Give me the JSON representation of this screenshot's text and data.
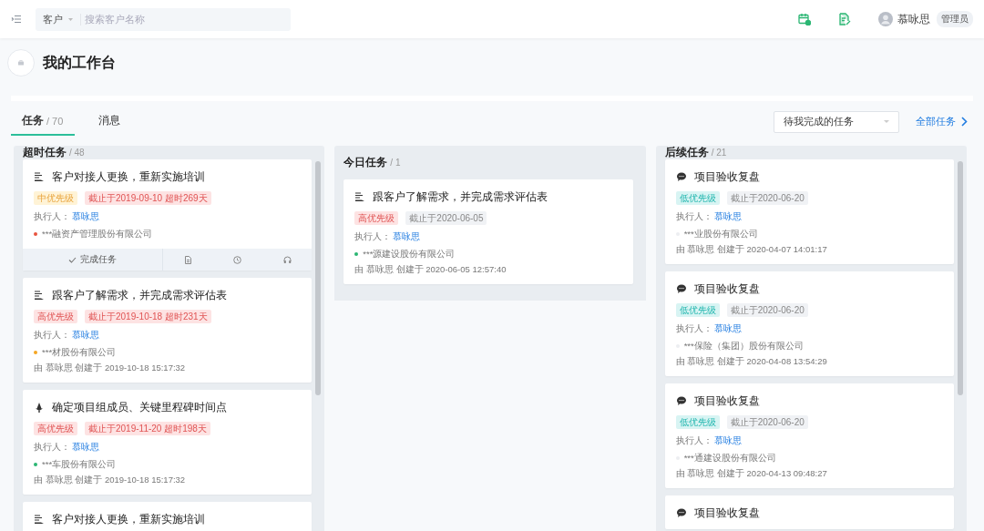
{
  "header": {
    "scope": "客户",
    "placeholder": "搜索客户名称",
    "user": {
      "name": "慕咏思",
      "role": "管理员"
    }
  },
  "page": {
    "title": "我的工作台"
  },
  "tabs": [
    {
      "label": "任务",
      "count": "/ 70",
      "selected": true
    },
    {
      "label": "消息",
      "selected": false
    }
  ],
  "filter": {
    "value": "待我完成的任务"
  },
  "all_link": "全部任务",
  "columns": [
    {
      "title": "超时任务",
      "count": "/ 48",
      "scrollbar": true,
      "cards": [
        {
          "kind": "list",
          "title": "客户对接人更换，重新实施培训",
          "priority": {
            "label": "中优先级",
            "kind": "mid"
          },
          "deadline": {
            "label": "截止于2019-09-10 超时269天",
            "overdue": true
          },
          "assignee_label": "执行人：",
          "assignee": "慕咏思",
          "company": "***融资产管理股份有限公司",
          "color": "#e8543f",
          "actions": {
            "complete": "完成任务"
          }
        },
        {
          "kind": "list",
          "title": "跟客户了解需求，并完成需求评估表",
          "priority": {
            "label": "高优先级",
            "kind": "high"
          },
          "deadline": {
            "label": "截止于2019-10-18 超时231天",
            "overdue": true
          },
          "assignee_label": "执行人：",
          "assignee": "慕咏思",
          "company": "***材股份有限公司",
          "color": "#f5a623",
          "created": "由 慕咏思 创建于 2019-10-18 15:17:32"
        },
        {
          "kind": "bell",
          "title": "确定项目组成员、关键里程碑时间点",
          "priority": {
            "label": "高优先级",
            "kind": "high"
          },
          "deadline": {
            "label": "截止于2019-11-20 超时198天",
            "overdue": true
          },
          "assignee_label": "执行人：",
          "assignee": "慕咏思",
          "company": "***车股份有限公司",
          "color": "#2bb673",
          "created": "由 慕咏思 创建于 2019-10-18 15:17:32"
        },
        {
          "kind": "list",
          "title": "客户对接人更换，重新实施培训"
        }
      ]
    },
    {
      "title": "今日任务",
      "count": "/ 1",
      "scrollbar": false,
      "cards": [
        {
          "kind": "list",
          "title": "跟客户了解需求，并完成需求评估表",
          "priority": {
            "label": "高优先级",
            "kind": "high"
          },
          "deadline": {
            "label": "截止于2020-06-05",
            "overdue": false
          },
          "assignee_label": "执行人：",
          "assignee": "慕咏思",
          "company": "***源建设股份有限公司",
          "color": "#2bb673",
          "created": "由 慕咏思 创建于 2020-06-05 12:57:40"
        }
      ]
    },
    {
      "title": "后续任务",
      "count": "/ 21",
      "scrollbar": true,
      "cards": [
        {
          "kind": "chat",
          "title": "项目验收复盘",
          "priority": {
            "label": "低优先级",
            "kind": "low"
          },
          "deadline": {
            "label": "截止于2020-06-20",
            "overdue": false
          },
          "assignee_label": "执行人：",
          "assignee": "慕咏思",
          "company": "***业股份有限公司",
          "color": "#eceef1",
          "created": "由 慕咏思 创建于 2020-04-07 14:01:17"
        },
        {
          "kind": "chat",
          "title": "项目验收复盘",
          "priority": {
            "label": "低优先级",
            "kind": "low"
          },
          "deadline": {
            "label": "截止于2020-06-20",
            "overdue": false
          },
          "assignee_label": "执行人：",
          "assignee": "慕咏思",
          "company": "***保险（集团）股份有限公司",
          "color": "#eceef1",
          "created": "由 慕咏思 创建于 2020-04-08 13:54:29"
        },
        {
          "kind": "chat",
          "title": "项目验收复盘",
          "priority": {
            "label": "低优先级",
            "kind": "low"
          },
          "deadline": {
            "label": "截止于2020-06-20",
            "overdue": false
          },
          "assignee_label": "执行人：",
          "assignee": "慕咏思",
          "company": "***通建设股份有限公司",
          "color": "#eceef1",
          "created": "由 慕咏思 创建于 2020-04-13 09:48:27"
        },
        {
          "kind": "chat",
          "title": "项目验收复盘"
        }
      ]
    }
  ]
}
